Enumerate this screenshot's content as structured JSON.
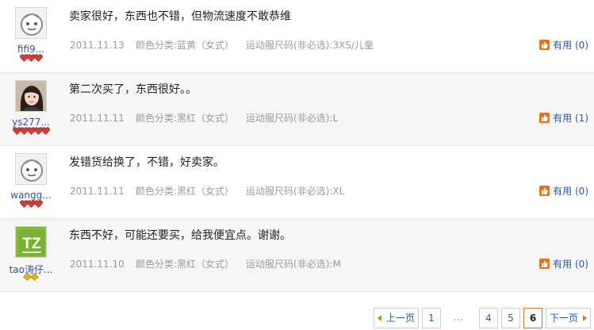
{
  "reviews": [
    {
      "username": "fifi9...",
      "avatar": "default-avatar",
      "rank_icons": [
        "heart",
        "heart",
        "heart"
      ],
      "content": "卖家很好，东西也不错，但物流速度不敢恭维",
      "date": "2011.11.13",
      "color_spec": "颜色分类:蓝黄（女式）",
      "size_spec": "运动服尺码(非必选):3XS/儿童",
      "useful_label": "有用",
      "useful_count": "(0)"
    },
    {
      "username": "ys277...",
      "avatar": "user-photo",
      "rank_icons": [
        "heart",
        "heart",
        "heart",
        "heart",
        "heart"
      ],
      "content": "第二次买了，东西很好。。",
      "date": "2011.11.11",
      "color_spec": "颜色分类:黑红（女式）",
      "size_spec": "运动服尺码(非必选):L",
      "useful_label": "有用",
      "useful_count": "(1)"
    },
    {
      "username": "wangg...",
      "avatar": "default-avatar",
      "rank_icons": [
        "heart",
        "heart",
        "heart"
      ],
      "content": "发错货给换了，不错，好卖家。",
      "date": "2011.11.11",
      "color_spec": "颜色分类:黑红（女式）",
      "size_spec": "运动服尺码(非必选):XL",
      "useful_label": "有用",
      "useful_count": "(0)"
    },
    {
      "username": "tao涛仔...",
      "avatar": "tz-logo",
      "avatar_text": "TZ",
      "rank_icons": [
        "diamond",
        "diamond"
      ],
      "content": "东西不好，可能还要买，给我便宜点。谢谢。",
      "date": "2011.11.10",
      "color_spec": "颜色分类:黑红（女式）",
      "size_spec": "运动服尺码(非必选):M",
      "useful_label": "有用",
      "useful_count": "(0)"
    }
  ],
  "pagination": {
    "prev_label": "上一页",
    "next_label": "下一页",
    "first_page": "1",
    "ellipsis": "...",
    "pages": [
      "4",
      "5",
      "6"
    ],
    "current_page": "6"
  },
  "colors": {
    "accent": "#e8711e",
    "link": "#2a55a8",
    "heart": "#d83a3a",
    "diamond": "#e6b21c",
    "meta": "#9a9a9a"
  }
}
